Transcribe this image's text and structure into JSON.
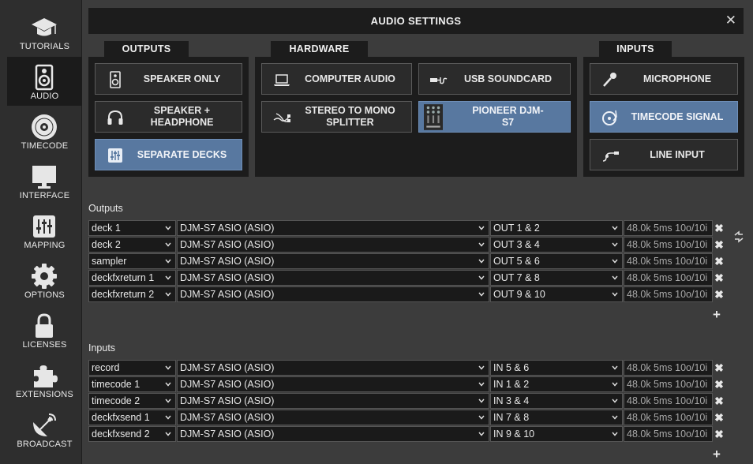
{
  "sidebar": {
    "items": [
      {
        "label": "TUTORIALS",
        "icon": "graduation-cap-icon"
      },
      {
        "label": "AUDIO",
        "icon": "speaker-icon",
        "active": true
      },
      {
        "label": "TIMECODE",
        "icon": "vinyl-icon"
      },
      {
        "label": "INTERFACE",
        "icon": "monitor-icon"
      },
      {
        "label": "MAPPING",
        "icon": "sliders-icon"
      },
      {
        "label": "OPTIONS",
        "icon": "gear-icon"
      },
      {
        "label": "LICENSES",
        "icon": "lock-icon"
      },
      {
        "label": "EXTENSIONS",
        "icon": "puzzle-icon"
      },
      {
        "label": "BROADCAST",
        "icon": "satellite-dish-icon"
      }
    ]
  },
  "header": {
    "title": "AUDIO SETTINGS",
    "close": "✕"
  },
  "outputs_panel": {
    "tab": "OUTPUTS",
    "buttons": [
      {
        "label": "SPEAKER ONLY",
        "icon": "speaker-icon",
        "selected": false
      },
      {
        "label": "SPEAKER + HEADPHONE",
        "icon": "headphones-icon",
        "selected": false
      },
      {
        "label": "SEPARATE DECKS",
        "icon": "sliders-icon",
        "selected": true
      }
    ]
  },
  "hardware_panel": {
    "tab": "HARDWARE",
    "buttons": [
      {
        "label": "COMPUTER AUDIO",
        "icon": "laptop-icon",
        "selected": false
      },
      {
        "label": "USB SOUNDCARD",
        "icon": "usb-cable-icon",
        "selected": false
      },
      {
        "label": "STEREO TO MONO SPLITTER",
        "icon": "splitter-cable-icon",
        "selected": false
      },
      {
        "label": "PIONEER DJM-S7",
        "icon": "mixer-icon",
        "selected": true
      }
    ]
  },
  "inputs_panel": {
    "tab": "INPUTS",
    "buttons": [
      {
        "label": "MICROPHONE",
        "icon": "microphone-icon",
        "selected": false
      },
      {
        "label": "TIMECODE SIGNAL",
        "icon": "turntable-icon",
        "selected": true
      },
      {
        "label": "LINE INPUT",
        "icon": "line-cable-icon",
        "selected": false
      }
    ]
  },
  "outputs": {
    "label": "Outputs",
    "rows": [
      {
        "channel": "deck 1",
        "device": "DJM-S7 ASIO (ASIO)",
        "port": "OUT 1 & 2",
        "info": "48.0k 5ms 10o/10i"
      },
      {
        "channel": "deck 2",
        "device": "DJM-S7 ASIO (ASIO)",
        "port": "OUT 3 & 4",
        "info": "48.0k 5ms 10o/10i"
      },
      {
        "channel": "sampler",
        "device": "DJM-S7 ASIO (ASIO)",
        "port": "OUT 5 & 6",
        "info": "48.0k 5ms 10o/10i"
      },
      {
        "channel": "deckfxreturn 1",
        "device": "DJM-S7 ASIO (ASIO)",
        "port": "OUT 7 & 8",
        "info": "48.0k 5ms 10o/10i"
      },
      {
        "channel": "deckfxreturn 2",
        "device": "DJM-S7 ASIO (ASIO)",
        "port": "OUT 9 & 10",
        "info": "48.0k 5ms 10o/10i"
      }
    ],
    "remove": "✖",
    "add": "+"
  },
  "inputs": {
    "label": "Inputs",
    "rows": [
      {
        "channel": "record",
        "device": "DJM-S7 ASIO (ASIO)",
        "port": "IN 5 & 6",
        "info": "48.0k 5ms 10o/10i"
      },
      {
        "channel": "timecode 1",
        "device": "DJM-S7 ASIO (ASIO)",
        "port": "IN 1 & 2",
        "info": "48.0k 5ms 10o/10i"
      },
      {
        "channel": "timecode 2",
        "device": "DJM-S7 ASIO (ASIO)",
        "port": "IN 3 & 4",
        "info": "48.0k 5ms 10o/10i"
      },
      {
        "channel": "deckfxsend 1",
        "device": "DJM-S7 ASIO (ASIO)",
        "port": "IN 7 & 8",
        "info": "48.0k 5ms 10o/10i"
      },
      {
        "channel": "deckfxsend 2",
        "device": "DJM-S7 ASIO (ASIO)",
        "port": "IN 9 & 10",
        "info": "48.0k 5ms 10o/10i"
      }
    ],
    "remove": "✖",
    "add": "+"
  },
  "colors": {
    "accent": "#5878a0",
    "panel": "#1c1c1c",
    "background": "#3c3c3c"
  }
}
